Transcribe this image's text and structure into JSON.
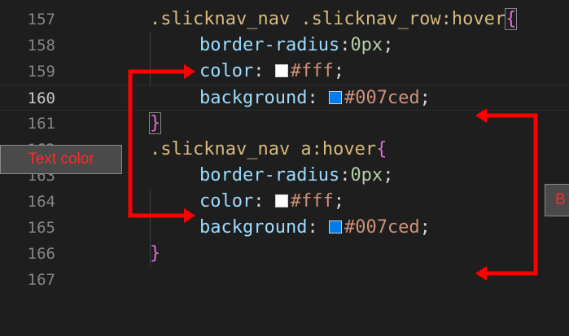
{
  "colors": {
    "background": "#1e1e1e",
    "selector": "#d7ba7d",
    "property": "#9cdcfe",
    "value": "#ce9178",
    "number": "#b5cea8",
    "brace": "#da70d6",
    "annotation_red": "#ff2a2a",
    "swatch_white": "#ffffff",
    "swatch_blue": "#007ced"
  },
  "editor": {
    "lines": [
      {
        "number": "157",
        "text": ".slicknav_nav .slicknav_row:hover",
        "brace": "{"
      },
      {
        "number": "158",
        "prop": "border-radius",
        "value": "0px"
      },
      {
        "number": "159",
        "prop": "color",
        "value": "#fff"
      },
      {
        "number": "160",
        "prop": "background",
        "value": "#007ced"
      },
      {
        "number": "161",
        "brace": "}"
      },
      {
        "number": "162",
        "text": ".slicknav_nav a:hover",
        "brace": "{"
      },
      {
        "number": "163",
        "prop": "border-radius",
        "value": "0px"
      },
      {
        "number": "164",
        "prop": "color",
        "value": "#fff"
      },
      {
        "number": "165",
        "prop": "background",
        "value": "#007ced"
      },
      {
        "number": "166",
        "brace": "}"
      },
      {
        "number": "167"
      }
    ]
  },
  "annotations": {
    "text_color_label": "Text color",
    "background_label_partial": "B"
  }
}
